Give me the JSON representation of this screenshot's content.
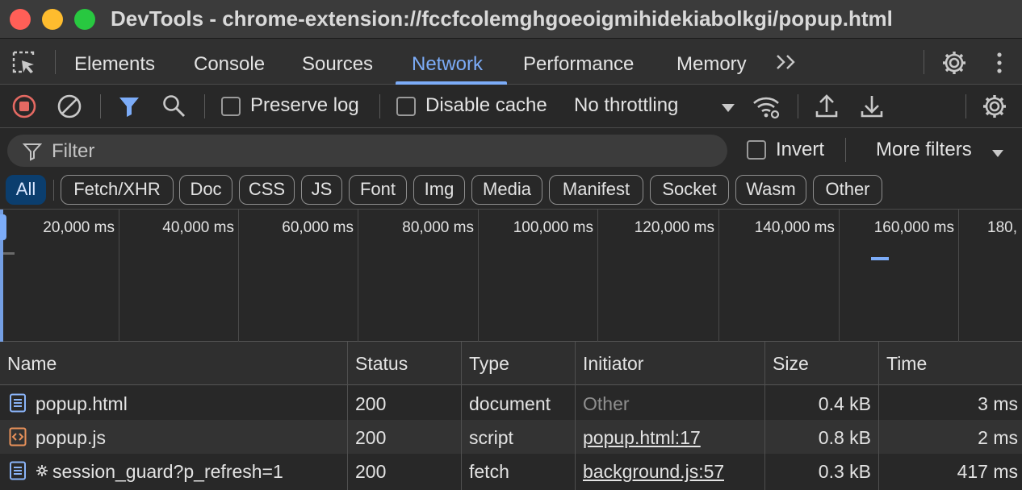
{
  "window": {
    "title": "DevTools - chrome-extension://fccfcolemghgoeoigmihidekiabolkgi/popup.html"
  },
  "tabs": [
    "Elements",
    "Console",
    "Sources",
    "Network",
    "Performance",
    "Memory"
  ],
  "active_tab": "Network",
  "toolbar": {
    "preserve_log_label": "Preserve log",
    "preserve_log_checked": false,
    "disable_cache_label": "Disable cache",
    "disable_cache_checked": false,
    "throttling_value": "No throttling"
  },
  "filter": {
    "placeholder": "Filter",
    "invert_label": "Invert",
    "more_filters_label": "More filters"
  },
  "type_filters": [
    "All",
    "Fetch/XHR",
    "Doc",
    "CSS",
    "JS",
    "Font",
    "Img",
    "Media",
    "Manifest",
    "Socket",
    "Wasm",
    "Other"
  ],
  "active_type_filter": "All",
  "timeline": {
    "tick_labels": [
      "20,000 ms",
      "40,000 ms",
      "60,000 ms",
      "80,000 ms",
      "100,000 ms",
      "120,000 ms",
      "140,000 ms",
      "160,000 ms",
      "180,"
    ]
  },
  "table": {
    "columns": {
      "name": "Name",
      "status": "Status",
      "type": "Type",
      "initiator": "Initiator",
      "size": "Size",
      "time": "Time"
    },
    "rows": [
      {
        "icon": "document-icon",
        "name": "popup.html",
        "status": "200",
        "type": "document",
        "initiator": "Other",
        "size": "0.4 kB",
        "time": "3 ms"
      },
      {
        "icon": "script-icon",
        "name": "popup.js",
        "status": "200",
        "type": "script",
        "initiator": "popup.html:17",
        "size": "0.8 kB",
        "time": "2 ms"
      },
      {
        "icon": "document-icon",
        "name": "session_guard?p_refresh=1",
        "status": "200",
        "type": "fetch",
        "initiator": "background.js:57",
        "size": "0.3 kB",
        "time": "417 ms"
      }
    ]
  },
  "colors": {
    "accent": "#7cacf8",
    "record_red": "#e46962",
    "script_orange": "#e8915a",
    "doc_blue": "#8ab4f8"
  }
}
